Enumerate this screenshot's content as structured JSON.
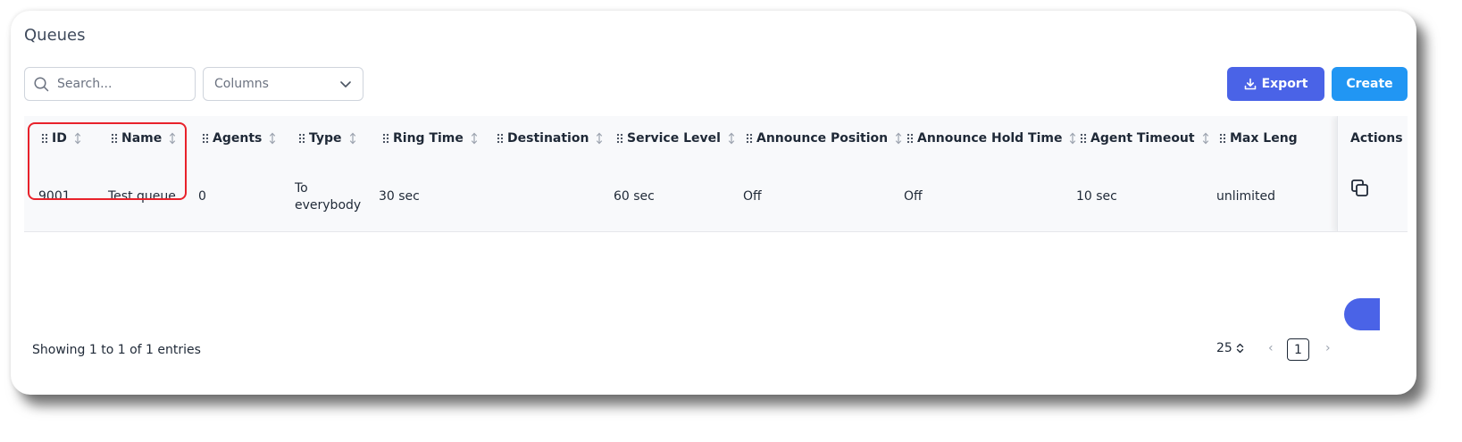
{
  "page": {
    "title": "Queues"
  },
  "toolbar": {
    "search_placeholder": "Search...",
    "columns_label": "Columns",
    "export_label": "Export",
    "create_label": "Create"
  },
  "table": {
    "headers": [
      "ID",
      "Name",
      "Agents",
      "Type",
      "Ring Time",
      "Destination",
      "Service Level",
      "Announce Position",
      "Announce Hold Time",
      "Agent Timeout",
      "Max Leng"
    ],
    "actions_header": "Actions",
    "rows": [
      {
        "id": "9001",
        "name": "Test queue",
        "agents": "0",
        "type_line1": "To",
        "type_line2": "everybody",
        "ring_time": "30 sec",
        "destination": "",
        "service_level": "60 sec",
        "announce_position": "Off",
        "announce_hold_time": "Off",
        "agent_timeout": "10 sec",
        "max_length": "unlimited"
      }
    ]
  },
  "footer": {
    "showing": "Showing 1 to 1 of 1 entries",
    "page_size": "25",
    "prev": "‹",
    "next": "›",
    "current_page": "1"
  },
  "icons": {
    "search": "search-icon",
    "chevron": "chevron-down-icon",
    "export": "download-icon",
    "grip": "drag-handle-icon",
    "sort": "sort-icon",
    "copy": "copy-icon",
    "page_size": "up-down-chevron-icon"
  },
  "colors": {
    "export_button": "#4a63e7",
    "create_button": "#2196f3",
    "highlight": "#e8222b"
  }
}
